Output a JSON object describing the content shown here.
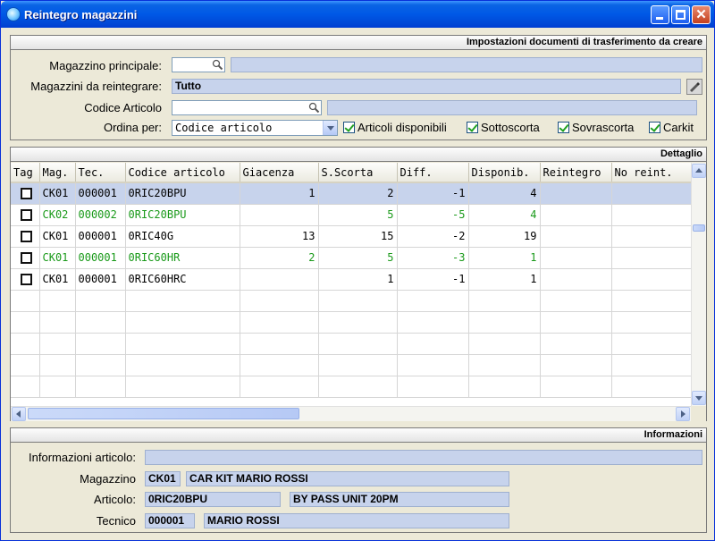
{
  "window": {
    "title": "Reintegro magazzini"
  },
  "settings": {
    "header": "Impostazioni documenti di trasferimento da creare",
    "magazzino_principale_label": "Magazzino principale:",
    "magazzini_label": "Magazzini da reintegrare:",
    "magazzini_value": "Tutto",
    "codice_articolo_label": "Codice Articolo",
    "ordina_label": "Ordina per:",
    "ordina_value": "Codice articolo",
    "checks": [
      "Articoli disponibili",
      "Sottoscorta",
      "Sovrascorta",
      "Carkit"
    ]
  },
  "detail": {
    "header": "Dettaglio",
    "columns": [
      "Tag",
      "Mag.",
      "Tec.",
      "Codice articolo",
      "Giacenza",
      "S.Scorta",
      "Diff.",
      "Disponib.",
      "Reintegro",
      "No reint."
    ],
    "rows": [
      {
        "mag": "CK01",
        "tec": "000001",
        "codice": "0RIC20BPU",
        "giacenza": "1",
        "scorta": "2",
        "diff": "-1",
        "disp": "4",
        "style": "sel"
      },
      {
        "mag": "CK02",
        "tec": "000002",
        "codice": "0RIC20BPU",
        "giacenza": "",
        "scorta": "5",
        "diff": "-5",
        "disp": "4",
        "style": "green"
      },
      {
        "mag": "CK01",
        "tec": "000001",
        "codice": "0RIC40G",
        "giacenza": "13",
        "scorta": "15",
        "diff": "-2",
        "disp": "19",
        "style": ""
      },
      {
        "mag": "CK01",
        "tec": "000001",
        "codice": "0RIC60HR",
        "giacenza": "2",
        "scorta": "5",
        "diff": "-3",
        "disp": "1",
        "style": "green"
      },
      {
        "mag": "CK01",
        "tec": "000001",
        "codice": "0RIC60HRC",
        "giacenza": "",
        "scorta": "1",
        "diff": "-1",
        "disp": "1",
        "style": ""
      }
    ],
    "empty_rows": 5
  },
  "info": {
    "header": "Informazioni",
    "info_articolo_label": "Informazioni articolo:",
    "magazzino_label": "Magazzino",
    "magazzino_code": "CK01",
    "magazzino_name": "CAR KIT MARIO ROSSI",
    "articolo_label": "Articolo:",
    "articolo_code": "0RIC20BPU",
    "articolo_desc": "BY PASS UNIT 20PM",
    "tecnico_label": "Tecnico",
    "tecnico_code": "000001",
    "tecnico_name": "MARIO ROSSI"
  }
}
